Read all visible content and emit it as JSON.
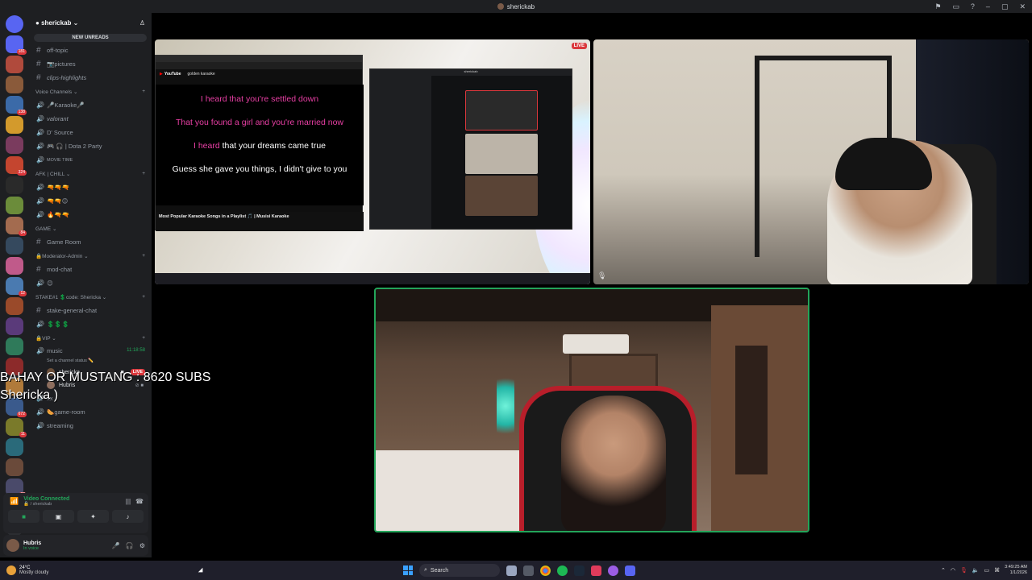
{
  "window": {
    "title": "sherickab"
  },
  "servers": {
    "badges": [
      "181",
      "",
      "",
      "138",
      "",
      "",
      "324",
      "",
      "",
      "84",
      "",
      "",
      "12",
      "",
      "",
      "",
      "",
      "",
      "672",
      "11",
      "",
      "",
      "32"
    ]
  },
  "guild": {
    "name": "sherickab",
    "new_unreads": "NEW UNREADS"
  },
  "text_channels": [
    {
      "name": "off-topic"
    },
    {
      "name": "📷pictures"
    },
    {
      "name": "clips-highlights"
    }
  ],
  "categories": {
    "voice": "Voice Channels",
    "afk": "AFK | CHILL",
    "game": "GAME",
    "mod": "Moderator-Admin",
    "stake": "STAKE#1 💲code: Shericka",
    "vip": "VIP"
  },
  "voice_channels": [
    {
      "name": "🎤Karaoke🎤"
    },
    {
      "name": "valorant"
    },
    {
      "name": "D' Source"
    },
    {
      "name": "🎮 🎧 | Dota 2 Party"
    },
    {
      "name": "MOVIE TIME"
    }
  ],
  "afk_channels": [
    {
      "name": "🔫🔫🔫"
    },
    {
      "name": "🔫🔫😊"
    },
    {
      "name": "🔥🔫🔫"
    }
  ],
  "game_channels": [
    {
      "name": "Game Room"
    }
  ],
  "mod_channels": [
    {
      "name": "mod-chat"
    }
  ],
  "stake_channels": [
    {
      "name": "stake-general-chat"
    },
    {
      "name": "💲💲💲"
    }
  ],
  "music_section": {
    "name": "music",
    "time": "11:18:58",
    "status_hint": "Set a channel status ✏️",
    "users": [
      {
        "name": "shericka",
        "live": "LIVE"
      },
      {
        "name": "Hubris"
      }
    ]
  },
  "extra_channels": [
    {
      "name": "xx"
    },
    {
      "name": "🌭game-room"
    },
    {
      "name": "streaming"
    }
  ],
  "voice_panel": {
    "status": "Video Connected",
    "channel": "🔒 / sherickab"
  },
  "user_panel": {
    "name": "Hubris",
    "status": "In voice"
  },
  "screen_share": {
    "live": "LIVE",
    "yt_search": "golden karaoke",
    "lyrics": [
      {
        "pink": "I heard that you're settled down",
        "white": ""
      },
      {
        "pink": "That you found a girl and you're married now",
        "white": ""
      },
      {
        "pink": "I heard",
        "white": " that your dreams came true"
      },
      {
        "pink": "",
        "white": "Guess she gave you things, I didn't give to you"
      }
    ],
    "video_title": "Most Popular Karaoke Songs in a Playlist 🎵 | Musisi Karaoke",
    "mini_discord_title": "sherickab"
  },
  "overlay": {
    "line1": "BAHAY OR MUSTANG : 8620 SUBS",
    "line2": "Shericka )"
  },
  "taskbar": {
    "temp": "24°C",
    "weather": "Mostly cloudy",
    "search": "Search",
    "time": "3:49:25 AM",
    "date": "1/1/2026"
  }
}
